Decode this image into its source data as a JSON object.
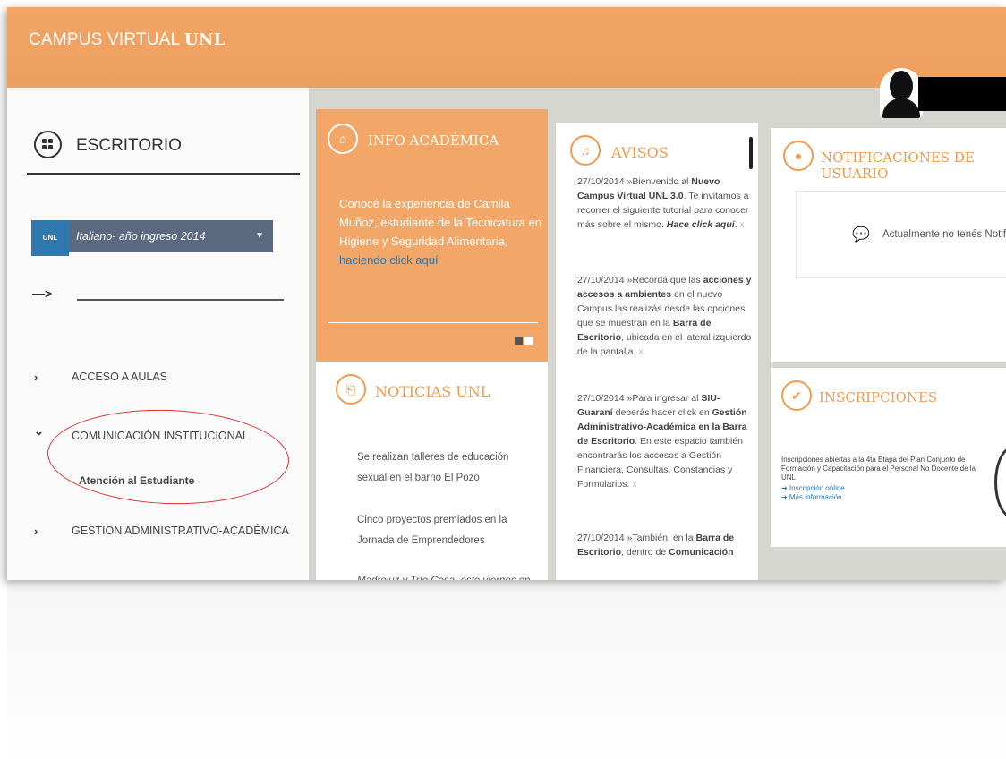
{
  "header": {
    "brand": "CAMPUS VIRTUAL",
    "brand_bold": "UNL"
  },
  "sidebar": {
    "title": "ESCRITORIO",
    "badge": "UNL",
    "course": "Italiano- año ingreso 2014",
    "arrow": "—>",
    "items": [
      {
        "label": "ACCESO A AULAS",
        "chevron": "›"
      },
      {
        "label": "COMUNICACIÓN INSTITUCIONAL",
        "chevron": "⌄"
      },
      {
        "label": "GESTION ADMINISTRATIVO-ACADÉMICA",
        "chevron": "›"
      }
    ],
    "subitem": "Atención al Estudiante"
  },
  "info": {
    "title": "INFO ACADÉMICA",
    "text": "Conocé la experiencia de Camila Muñoz, estudiante de la Tecnicatura en Higiene y Seguridad Alimentaria,",
    "link": "haciendo click aquí"
  },
  "news": {
    "title": "NOTICIAS UNL",
    "items": [
      "Se realizan talleres de educación sexual en el barrio El Pozo",
      "Cinco proyectos premiados en la Jornada de Emprendedores",
      "Madreluz y Trío Cosa, este viernes en"
    ]
  },
  "avisos": {
    "title": "AVISOS",
    "items": [
      {
        "date": "27/10/2014 »",
        "pre": "Bienvenido al ",
        "b1": "Nuevo Campus Virtual UNL 3.0",
        "mid": ". Te invitamos a recorrer el siguiente tutorial para conocer más sobre el mismo. ",
        "b2": "Hace click aquí",
        "post": "."
      },
      {
        "date": "27/10/2014 »",
        "pre": "Recordá que las ",
        "b1": "acciones y accesos a ambientes",
        "mid": " en el nuevo Campus las realizás desde las opciones que se muestran en la ",
        "b2": "Barra de Escritorio",
        "post": ", ubicada en el lateral izquierdo de la pantalla."
      },
      {
        "date": "27/10/2014 »",
        "pre": "Para ingresar al ",
        "b1": "SIU-Guaraní",
        "mid": " deberás hacer click en ",
        "b2": "Gestión Administrativo-Académica en la Barra de Escritorio",
        "post": ". En este espacio también encontrarás los accesos a Gestión Financiera, Consultas, Constancias y Formularios."
      },
      {
        "date": "27/10/2014 »",
        "pre": "También, en la ",
        "b1": "Barra de Escritorio",
        "mid": ", dentro de ",
        "b2": "Comunicación",
        "post": ""
      }
    ]
  },
  "notifications": {
    "title": "NOTIFICACIONES DE USUARIO",
    "empty": "Actualmente no tenés Notificaciones"
  },
  "inscripciones": {
    "title": "INSCRIPCIONES",
    "text": "Inscripciones abiertas a la 4ta Etapa del Plan Conjunto de Formación y Capacitación para el Personal No Docente de la UNL",
    "link1": "➜ Inscripción online",
    "link2": "➜ Más información"
  },
  "colors": {
    "accent": "#f39a4e",
    "header": "#efa262",
    "link": "#2b78b6",
    "select": "#5b6980"
  }
}
